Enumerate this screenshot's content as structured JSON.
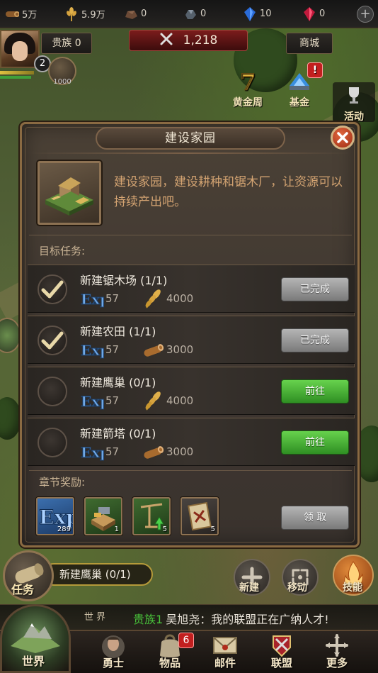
{
  "resources": [
    {
      "icon": "wood-icon",
      "value": "5万"
    },
    {
      "icon": "wheat-icon",
      "value": "5.9万"
    },
    {
      "icon": "stone-icon",
      "value": "0"
    },
    {
      "icon": "iron-icon",
      "value": "0"
    },
    {
      "icon": "blue-gem-icon",
      "value": "10"
    },
    {
      "icon": "red-gem-icon",
      "value": "0"
    }
  ],
  "header": {
    "noble_label": "贵族 0",
    "level": "2",
    "power": "1000",
    "battle_value": "1,218",
    "shop_label": "商城",
    "events": [
      {
        "label": "黄金周",
        "icon": "gold-week-icon"
      },
      {
        "label": "基金",
        "icon": "fund-icon",
        "badge": "!"
      },
      {
        "label": "活动",
        "icon": "trophy-icon"
      }
    ]
  },
  "modal": {
    "title": "建设家园",
    "description": "建设家园，建设耕种和锯木厂，让资源可以持续产出吧。",
    "target_label": "目标任务:",
    "tasks": [
      {
        "name": "新建锯木场 (1/1)",
        "exp": "57",
        "resource_icon": "wheat-icon",
        "resource": "4000",
        "button": "已完成",
        "done": true
      },
      {
        "name": "新建农田 (1/1)",
        "exp": "57",
        "resource_icon": "wood-icon",
        "resource": "3000",
        "button": "已完成",
        "done": true
      },
      {
        "name": "新建鹰巢 (0/1)",
        "exp": "57",
        "resource_icon": "wheat-icon",
        "resource": "4000",
        "button": "前往",
        "done": false
      },
      {
        "name": "新建箭塔 (0/1)",
        "exp": "57",
        "resource_icon": "wood-icon",
        "resource": "3000",
        "button": "前往",
        "done": false
      }
    ],
    "exp_label": "EXP",
    "reward_label": "章节奖励:",
    "rewards": [
      {
        "icon": "exp-reward-icon",
        "count": "289"
      },
      {
        "icon": "resource-crate-icon",
        "count": "1"
      },
      {
        "icon": "build-upgrade-icon",
        "count": "5"
      },
      {
        "icon": "map-scroll-icon",
        "count": "5"
      }
    ],
    "claim_button": "领 取"
  },
  "bottom": {
    "quest_tracker": "新建鹰巢 (0/1)",
    "task_label": "任务",
    "actions": [
      {
        "label": "新建",
        "icon": "build-plus-icon"
      },
      {
        "label": "移动",
        "icon": "move-arrows-icon"
      },
      {
        "label": "技能",
        "icon": "flame-skill-icon"
      }
    ],
    "chat_tab": "世 界",
    "chat_channel": "贵族1",
    "chat_message": "吴旭尧：我的联盟正在广纳人才!",
    "nav": [
      {
        "label": "世界",
        "icon": "world-icon"
      },
      {
        "label": "勇士",
        "icon": "hero-icon"
      },
      {
        "label": "物品",
        "icon": "bag-icon",
        "badge": "6"
      },
      {
        "label": "邮件",
        "icon": "mail-icon"
      },
      {
        "label": "联盟",
        "icon": "alliance-icon"
      },
      {
        "label": "更多",
        "icon": "more-icon"
      }
    ]
  }
}
